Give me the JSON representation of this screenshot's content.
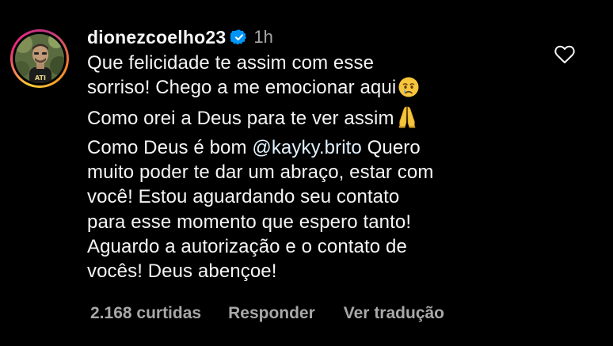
{
  "comment": {
    "username": "dionezcoelho23",
    "timestamp": "1h",
    "lines": [
      {
        "pre": "Que felicidade te assim com esse",
        "mention": "",
        "post": "",
        "emoji": ""
      },
      {
        "pre": "sorriso! Chego a me emocionar aqui",
        "mention": "",
        "post": "",
        "emoji": "crying-face-emoji"
      },
      {
        "pre": "Como orei a Deus para te ver assim",
        "mention": "",
        "post": "",
        "emoji": "folded-hands-emoji"
      },
      {
        "pre": "Como Deus é bom ",
        "mention": "@kayky.brito",
        "post": " Quero",
        "emoji": ""
      },
      {
        "pre": "muito poder te dar um abraço, estar com",
        "mention": "",
        "post": "",
        "emoji": ""
      },
      {
        "pre": "você! Estou aguardando seu contato",
        "mention": "",
        "post": "",
        "emoji": ""
      },
      {
        "pre": "para esse momento que espero tanto!",
        "mention": "",
        "post": "",
        "emoji": ""
      },
      {
        "pre": "Aguardo a autorização e o contato de",
        "mention": "",
        "post": "",
        "emoji": ""
      },
      {
        "pre": "vocês! Deus abençoe!",
        "mention": "",
        "post": "",
        "emoji": ""
      }
    ],
    "likes_label": "2.168 curtidas",
    "reply_label": "Responder",
    "translate_label": "Ver tradução"
  },
  "icons": {
    "verified": "verified-badge-icon",
    "like": "heart-outline-icon",
    "avatar": "profile-photo"
  },
  "colors": {
    "background": "#000000",
    "text": "#f5f5f5",
    "secondary_text": "#a8a8a8",
    "mention": "#e0f1ff",
    "verified_badge": "#0095f6"
  }
}
